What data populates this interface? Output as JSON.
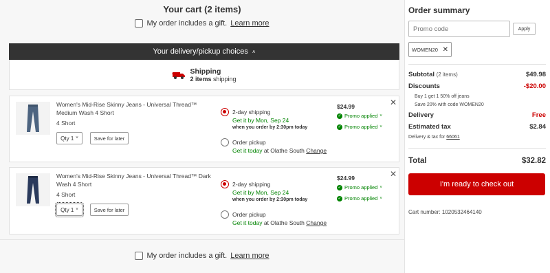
{
  "cart": {
    "title": "Your cart (2 items)",
    "gift_label": "My order includes a gift.",
    "learn_more": "Learn more"
  },
  "delivery": {
    "bar_label": "Your delivery/pickup choices",
    "shipping_title": "Shipping",
    "shipping_count": "2 items",
    "shipping_suffix": "shipping"
  },
  "items": [
    {
      "name": "Women's Mid-Rise Skinny Jeans - Universal Thread™ Medium Wash 4 Short",
      "size": "4 Short",
      "qty": "Qty 1",
      "save": "Save for later",
      "option1": "2-day shipping",
      "option1_date": "Get it by Mon, Sep 24",
      "option1_note": "when you order by 2:30pm today",
      "option2": "Order pickup",
      "option2_today": "Get it today",
      "option2_store": "at Olathe South",
      "change": "Change",
      "price": "$24.99",
      "promo1": "Promo applied",
      "promo2": "Promo applied",
      "wash_color": "#4d6480"
    },
    {
      "name": "Women's Mid-Rise Skinny Jeans - Universal Thread™ Dark Wash 4 Short",
      "size": "4 Short",
      "qty": "Qty 1",
      "save": "Save for later",
      "option1": "2-day shipping",
      "option1_date": "Get it by Mon, Sep 24",
      "option1_note": "when you order by 2:30pm today",
      "option2": "Order pickup",
      "option2_today": "Get it today",
      "option2_store": "at Olathe South",
      "change": "Change",
      "price": "$24.99",
      "promo1": "Promo applied",
      "promo2": "Promo applied",
      "wash_color": "#2a3a5c"
    }
  ],
  "summary": {
    "title": "Order summary",
    "promo_placeholder": "Promo code",
    "apply": "Apply",
    "code": "WOMEN20",
    "subtotal_label": "Subtotal",
    "subtotal_items": "(2 items)",
    "subtotal": "$49.98",
    "discounts_label": "Discounts",
    "discounts": "-$20.00",
    "discount_note1": "Buy 1 get 1 50% off jeans",
    "discount_note2": "Save 20% with code WOMEN20",
    "delivery_label": "Delivery",
    "delivery": "Free",
    "tax_label": "Estimated tax",
    "tax": "$2.84",
    "tax_note": "Delivery & tax for",
    "zip": "66061",
    "total_label": "Total",
    "total": "$32.82",
    "checkout": "I'm ready to check out",
    "cart_number": "Cart number: 1020532464140"
  },
  "colors": {
    "accent": "#cc0000",
    "green": "#008300",
    "bar": "#333333"
  }
}
